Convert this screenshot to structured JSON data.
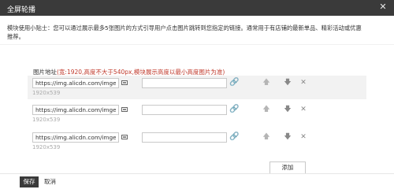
{
  "window": {
    "title": "全屏轮播",
    "close_symbol": "✕"
  },
  "tip": {
    "line1": "模块使用小贴士：您可以通过展示最多5张图片的方式引导用户点击图片跳转到您指定的链接。通常用于有店铺的最新单品、精彩活动或优惠",
    "line2": "推荐。"
  },
  "image_section": {
    "label": "图片地址",
    "hint": "(宽:1920,高度不大于540px,模块展示高度以最小高度图片为准)",
    "rows": [
      {
        "url": "https://img.alicdn.com/imgext",
        "link": "",
        "size": "1920x539",
        "up": "🡅",
        "down": "🡇",
        "delete": "✕"
      },
      {
        "url": "https://img.alicdn.com/imgext",
        "link": "",
        "size": "1920x539",
        "up": "🡅",
        "down": "🡇",
        "delete": "✕"
      },
      {
        "url": "https://img.alicdn.com/imgext",
        "link": "",
        "size": "1920x539",
        "up": "🡅",
        "down": "🡇",
        "delete": "✕"
      }
    ],
    "link_icon": "🔗"
  },
  "footer": {
    "add_label": "添加",
    "save_label": "保存",
    "cancel_label": "取消"
  }
}
